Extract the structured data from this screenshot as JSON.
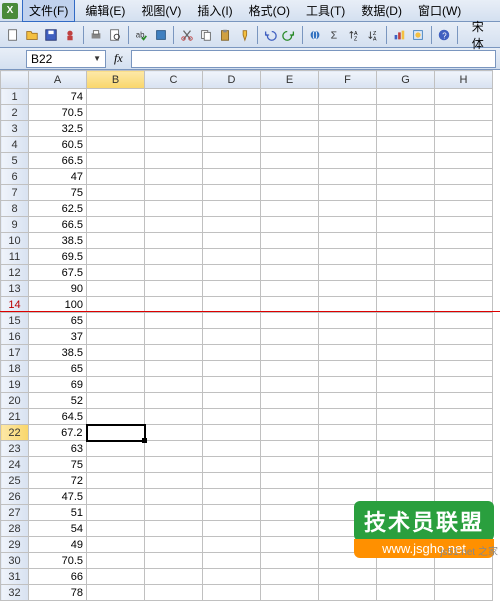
{
  "menu": {
    "file": "文件(F)",
    "edit": "编辑(E)",
    "view": "视图(V)",
    "insert": "插入(I)",
    "format": "格式(O)",
    "tools": "工具(T)",
    "data": "数据(D)",
    "window": "窗口(W)"
  },
  "font": "宋体",
  "namebox": "B22",
  "fx": "fx",
  "columns": [
    "A",
    "B",
    "C",
    "D",
    "E",
    "F",
    "G",
    "H"
  ],
  "selected_col": "B",
  "selected_row": 22,
  "marked_row": 14,
  "redline_after_row": 14,
  "row_count": 32,
  "cells": {
    "A": {
      "1": "74",
      "2": "70.5",
      "3": "32.5",
      "4": "60.5",
      "5": "66.5",
      "6": "47",
      "7": "75",
      "8": "62.5",
      "9": "66.5",
      "10": "38.5",
      "11": "69.5",
      "12": "67.5",
      "13": "90",
      "14": "100",
      "15": "65",
      "16": "37",
      "17": "38.5",
      "18": "65",
      "19": "69",
      "20": "52",
      "21": "64.5",
      "22": "67.2",
      "23": "63",
      "24": "75",
      "25": "72",
      "26": "47.5",
      "27": "51",
      "28": "54",
      "29": "49",
      "30": "70.5",
      "31": "66",
      "32": "78"
    }
  },
  "watermark": {
    "title": "技术员联盟",
    "url": "www.jsgho.net",
    "side": "js51.net 之家"
  }
}
